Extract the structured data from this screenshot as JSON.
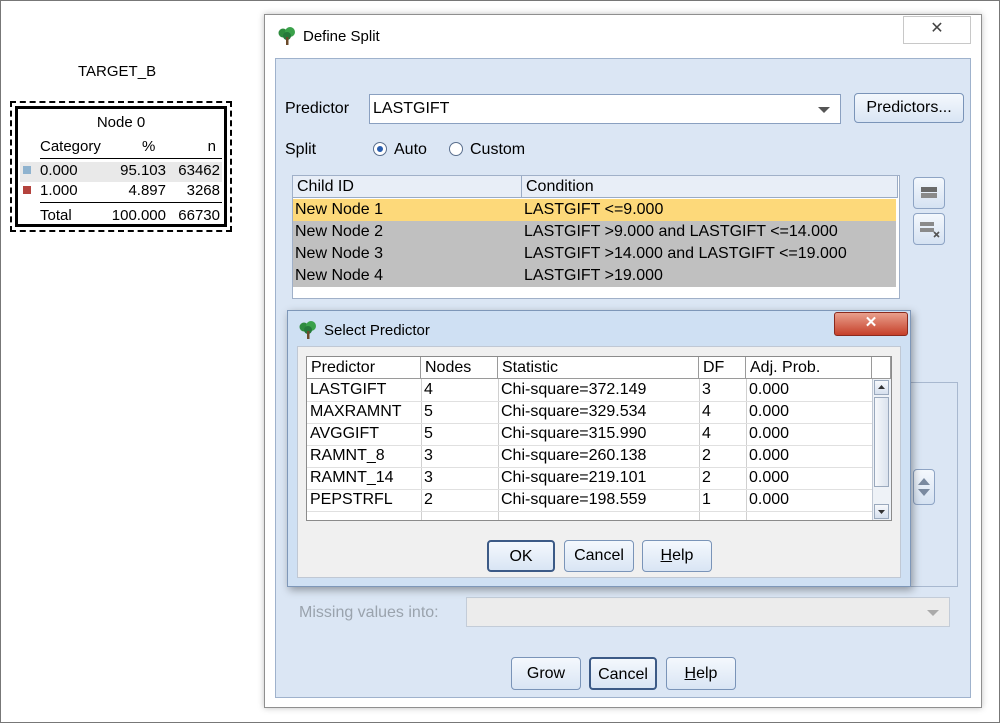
{
  "tree": {
    "target_label": "TARGET_B",
    "node_title": "Node 0",
    "headers": {
      "category": "Category",
      "percent": "%",
      "n": "n"
    },
    "rows": [
      {
        "category": "0.000",
        "percent": "95.103",
        "n": "63462",
        "color": "#8fb3cf"
      },
      {
        "category": "1.000",
        "percent": "4.897",
        "n": "3268",
        "color": "#b4433d"
      }
    ],
    "total": {
      "label": "Total",
      "percent": "100.000",
      "n": "66730"
    }
  },
  "define_split": {
    "title": "Define Split",
    "close_glyph": "✕",
    "predictor_label": "Predictor",
    "predictor_value": "LASTGIFT",
    "predictors_button": "Predictors...",
    "split_label": "Split",
    "auto_label": "Auto",
    "custom_label": "Custom",
    "table_headers": {
      "child": "Child ID",
      "condition": "Condition"
    },
    "rows": [
      {
        "child": "New Node 1",
        "condition": "LASTGIFT <=9.000"
      },
      {
        "child": "New Node 2",
        "condition": "LASTGIFT >9.000 and LASTGIFT <=14.000"
      },
      {
        "child": "New Node 3",
        "condition": "LASTGIFT >14.000 and LASTGIFT <=19.000"
      },
      {
        "child": "New Node 4",
        "condition": "LASTGIFT >19.000"
      }
    ],
    "missing_label": "Missing values into:",
    "grow_button": "Grow",
    "cancel_button": "Cancel",
    "help_button": "Help",
    "colors": {
      "selected_row": "#fdd97a",
      "other_rows": "#c0c0c0"
    }
  },
  "select_predictor": {
    "title": "Select Predictor",
    "close_glyph": "✕",
    "headers": {
      "predictor": "Predictor",
      "nodes": "Nodes",
      "statistic": "Statistic",
      "df": "DF",
      "prob": "Adj. Prob."
    },
    "rows": [
      {
        "predictor": "LASTGIFT",
        "nodes": "4",
        "statistic": "Chi-square=372.149",
        "df": "3",
        "prob": "0.000"
      },
      {
        "predictor": "MAXRAMNT",
        "nodes": "5",
        "statistic": "Chi-square=329.534",
        "df": "4",
        "prob": "0.000"
      },
      {
        "predictor": "AVGGIFT",
        "nodes": "5",
        "statistic": "Chi-square=315.990",
        "df": "4",
        "prob": "0.000"
      },
      {
        "predictor": "RAMNT_8",
        "nodes": "3",
        "statistic": "Chi-square=260.138",
        "df": "2",
        "prob": "0.000"
      },
      {
        "predictor": "RAMNT_14",
        "nodes": "3",
        "statistic": "Chi-square=219.101",
        "df": "2",
        "prob": "0.000"
      },
      {
        "predictor": "PEPSTRFL",
        "nodes": "2",
        "statistic": "Chi-square=198.559",
        "df": "1",
        "prob": "0.000"
      }
    ],
    "ok_button": "OK",
    "cancel_button": "Cancel",
    "help_button": "Help"
  }
}
